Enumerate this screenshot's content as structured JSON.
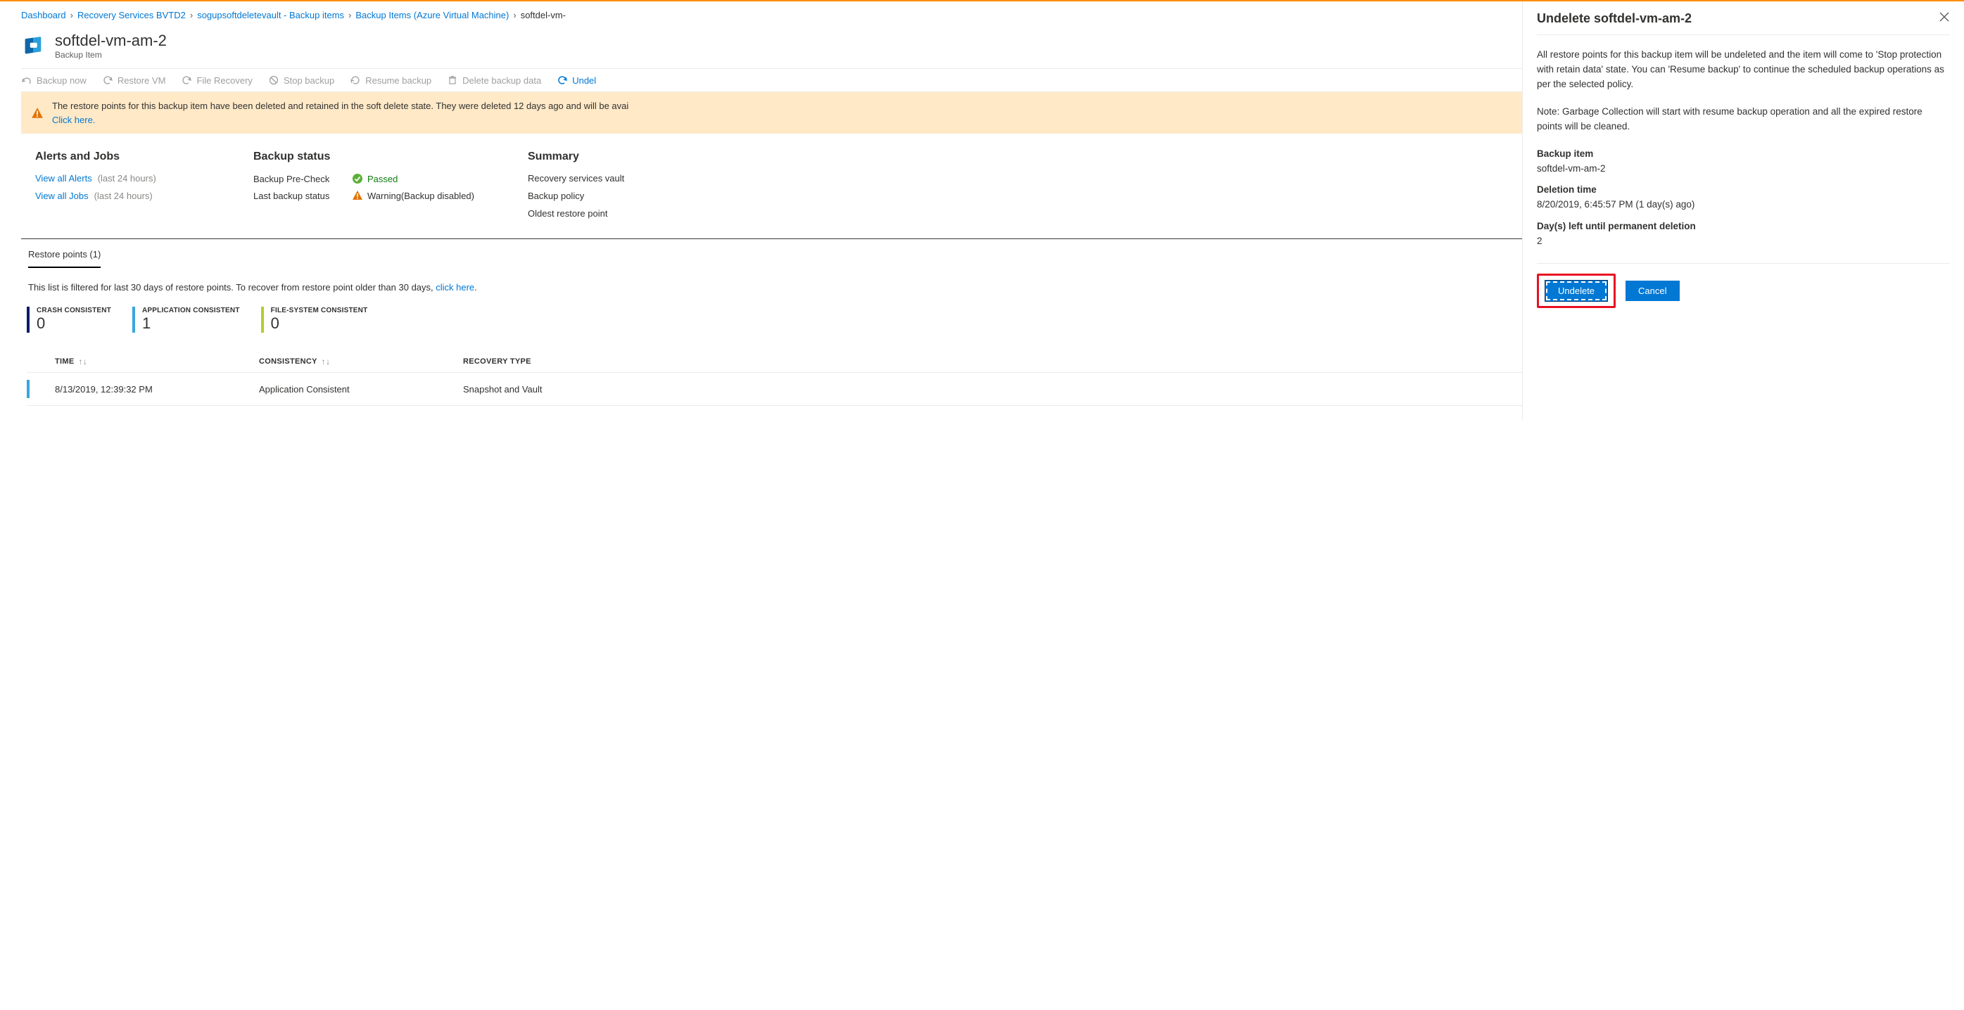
{
  "breadcrumb": {
    "items": [
      {
        "label": "Dashboard"
      },
      {
        "label": "Recovery Services BVTD2"
      },
      {
        "label": "sogupsoftdeletevault - Backup items"
      },
      {
        "label": "Backup Items (Azure Virtual Machine)"
      },
      {
        "label": "softdel-vm-"
      }
    ]
  },
  "page_title": {
    "title": "softdel-vm-am-2",
    "subtitle": "Backup Item"
  },
  "toolbar": {
    "backup_now": "Backup now",
    "restore_vm": "Restore VM",
    "file_recovery": "File Recovery",
    "stop_backup": "Stop backup",
    "resume_backup": "Resume backup",
    "delete_backup_data": "Delete backup data",
    "undelete": "Undel"
  },
  "alert": {
    "line1": "The restore points for this backup item have been deleted and retained in the soft delete state. They were deleted 12 days ago and will be avai",
    "line2_prefix": "",
    "click_here": "Click here."
  },
  "sections": {
    "alerts_jobs": {
      "title": "Alerts and Jobs",
      "view_alerts": "View all Alerts",
      "view_jobs": "View all Jobs",
      "hours_note": "(last 24 hours)"
    },
    "backup_status": {
      "title": "Backup status",
      "precheck_label": "Backup Pre-Check",
      "precheck_value": "Passed",
      "last_status_label": "Last backup status",
      "last_status_value": "Warning(Backup disabled)"
    },
    "summary": {
      "title": "Summary",
      "vault_label": "Recovery services vault",
      "policy_label": "Backup policy",
      "oldest_label": "Oldest restore point"
    }
  },
  "tabs": {
    "restore_points": "Restore points (1)"
  },
  "filter_note": {
    "prefix": "This list is filtered for last 30 days of restore points. To recover from restore point older than 30 days, ",
    "link": "click here",
    "suffix": "."
  },
  "counters": {
    "crash": {
      "label": "CRASH CONSISTENT",
      "value": "0"
    },
    "app": {
      "label": "APPLICATION CONSISTENT",
      "value": "1"
    },
    "fs": {
      "label": "FILE-SYSTEM CONSISTENT",
      "value": "0"
    }
  },
  "table": {
    "headers": {
      "time": "TIME",
      "consistency": "CONSISTENCY",
      "recovery_type": "RECOVERY TYPE"
    },
    "rows": [
      {
        "time": "8/13/2019, 12:39:32 PM",
        "consistency": "Application Consistent",
        "recovery_type": "Snapshot and Vault"
      }
    ]
  },
  "panel": {
    "title": "Undelete softdel-vm-am-2",
    "para1": "All restore points for this backup item will be undeleted and the item will come to 'Stop protection with retain data' state. You can 'Resume backup' to continue the scheduled backup operations as per the selected policy.",
    "para2": "Note: Garbage Collection will start with resume backup operation and all the expired restore points will be cleaned.",
    "backup_item_label": "Backup item",
    "backup_item_value": "softdel-vm-am-2",
    "deletion_time_label": "Deletion time",
    "deletion_time_value": "8/20/2019, 6:45:57 PM (1 day(s) ago)",
    "days_left_label": "Day(s) left until permanent deletion",
    "days_left_value": "2",
    "undelete_btn": "Undelete",
    "cancel_btn": "Cancel"
  }
}
